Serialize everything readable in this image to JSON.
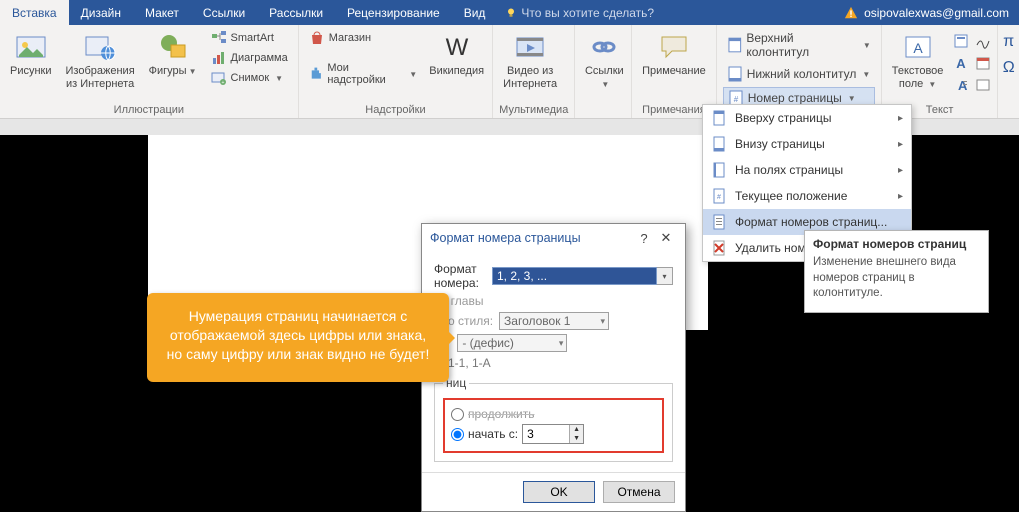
{
  "tabs": {
    "items": [
      "Вставка",
      "Дизайн",
      "Макет",
      "Ссылки",
      "Рассылки",
      "Рецензирование",
      "Вид"
    ],
    "active_index": 0,
    "tell_me": "Что вы хотите сделать?"
  },
  "account": {
    "email": "osipovalexwas@gmail.com"
  },
  "ribbon": {
    "illustrations": {
      "label": "Иллюстрации",
      "pictures": "Рисунки",
      "online_pictures": "Изображения\nиз Интернета",
      "shapes": "Фигуры",
      "smartart": "SmartArt",
      "chart": "Диаграмма",
      "screenshot": "Снимок"
    },
    "addins": {
      "label": "Надстройки",
      "store": "Магазин",
      "my_addins": "Мои надстройки",
      "wikipedia": "Википедия"
    },
    "media": {
      "label": "Мультимедиа",
      "video": "Видео из\nИнтернета"
    },
    "links": {
      "label": "",
      "links": "Ссылки"
    },
    "comments": {
      "label": "Примечания",
      "comment": "Примечание"
    },
    "header_footer": {
      "header": "Верхний колонтитул",
      "footer": "Нижний колонтитул",
      "page_number": "Номер страницы"
    },
    "text": {
      "label": "Текст",
      "textbox": "Текстовое\nполе"
    }
  },
  "pn_menu": {
    "top": "Вверху страницы",
    "bottom": "Внизу страницы",
    "margins": "На полях страницы",
    "current": "Текущее положение",
    "format": "Формат номеров страниц...",
    "remove": "Удалить ном"
  },
  "tooltip": {
    "title": "Формат номеров страниц",
    "body": "Изменение внешнего вида номеров страниц в колонтитуле."
  },
  "dialog": {
    "title": "Формат номера страницы",
    "format_label": "Формат номера:",
    "format_value": "1, 2, 3, ...",
    "include_chapter": "ер главы",
    "style_label": "о стиля:",
    "style_value": "Заголовок 1",
    "separator_value": "- (дефис)",
    "example": "1-1, 1-A",
    "group_label": "ниц",
    "continue": "продолжить",
    "start_at": "начать с:",
    "start_value": "3",
    "ok": "OK",
    "cancel": "Отмена"
  },
  "callout": "Нумерация страниц начинается с отображаемой здесь цифры или знака, но саму цифру или знак видно не будет!"
}
